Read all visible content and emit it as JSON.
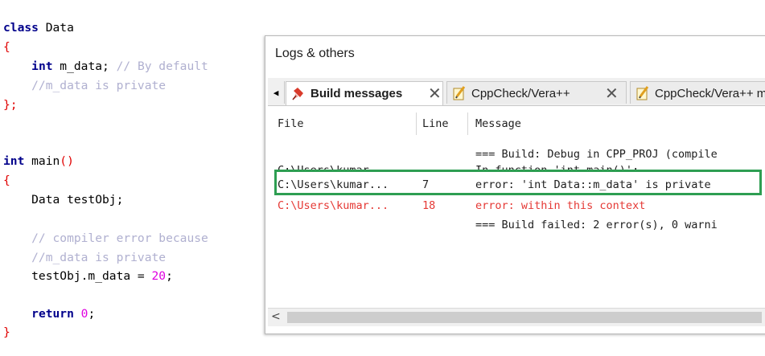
{
  "editor": {
    "lines": [
      {
        "t": 35,
        "parts": [
          [
            "kw",
            "class"
          ],
          [
            "pl",
            " Data"
          ]
        ]
      },
      {
        "t": 59,
        "parts": [
          [
            "br",
            "{"
          ]
        ]
      },
      {
        "t": 83,
        "parts": [
          [
            "pl",
            "    "
          ],
          [
            "kw",
            "int"
          ],
          [
            "pl",
            " m_data; "
          ],
          [
            "cm",
            "// By default"
          ]
        ]
      },
      {
        "t": 107,
        "parts": [
          [
            "cm",
            "    //m_data is private"
          ]
        ]
      },
      {
        "t": 131,
        "parts": [
          [
            "br",
            "};"
          ]
        ]
      },
      {
        "t": 201,
        "parts": [
          [
            "kw",
            "int"
          ],
          [
            "pl",
            " main"
          ],
          [
            "br",
            "()"
          ]
        ]
      },
      {
        "t": 225,
        "parts": [
          [
            "br",
            "{"
          ]
        ]
      },
      {
        "t": 249,
        "parts": [
          [
            "pl",
            "    Data testObj;"
          ]
        ]
      },
      {
        "t": 297,
        "parts": [
          [
            "cm",
            "    // compiler error because"
          ]
        ]
      },
      {
        "t": 321,
        "parts": [
          [
            "cm",
            "    //m_data is private"
          ]
        ]
      },
      {
        "t": 344,
        "parts": [
          [
            "pl",
            "    testObj.m_data = "
          ],
          [
            "nm",
            "20"
          ],
          [
            "pl",
            ";"
          ]
        ]
      },
      {
        "t": 391,
        "parts": [
          [
            "pl",
            "    "
          ],
          [
            "kw",
            "return"
          ],
          [
            "pl",
            " "
          ],
          [
            "nm",
            "0"
          ],
          [
            "pl",
            ";"
          ]
        ]
      },
      {
        "t": 414,
        "parts": [
          [
            "br",
            "}"
          ]
        ]
      }
    ]
  },
  "panel": {
    "title": "Logs & others",
    "scroll_left_label": "◀",
    "tabs": [
      {
        "label": "Build messages",
        "close": "✕"
      },
      {
        "label": "CppCheck/Vera++",
        "close": "✕"
      },
      {
        "label": "CppCheck/Vera++ m"
      }
    ],
    "columns": [
      "File",
      "Line",
      "Message"
    ],
    "rows": [
      {
        "file": "",
        "line": "",
        "message": "=== Build: Debug in CPP_PROJ (compile",
        "error": false
      },
      {
        "file": "C:\\Users\\kumar",
        "line": "",
        "message": "In function 'int main()':",
        "error": false
      },
      {
        "file": "C:\\Users\\kumar...",
        "line": "7",
        "message": "error: 'int Data::m_data' is private",
        "error": false
      },
      {
        "file": "C:\\Users\\kumar...",
        "line": "18",
        "message": "error: within this context",
        "error": true
      },
      {
        "file": "",
        "line": "",
        "message": "=== Build failed: 2 error(s), 0 warni",
        "error": false
      }
    ],
    "hscroll_left": "<"
  },
  "colors": {
    "highlight": "#2e9e52",
    "error_text": "#e53935",
    "keyword": "#00008b",
    "comment": "#b0b0d0",
    "bracket": "#e00000",
    "number": "#e000e0"
  },
  "icons": {
    "build_tab": "pushpin-icon",
    "cppcheck_tab": "pencil-note-icon"
  }
}
